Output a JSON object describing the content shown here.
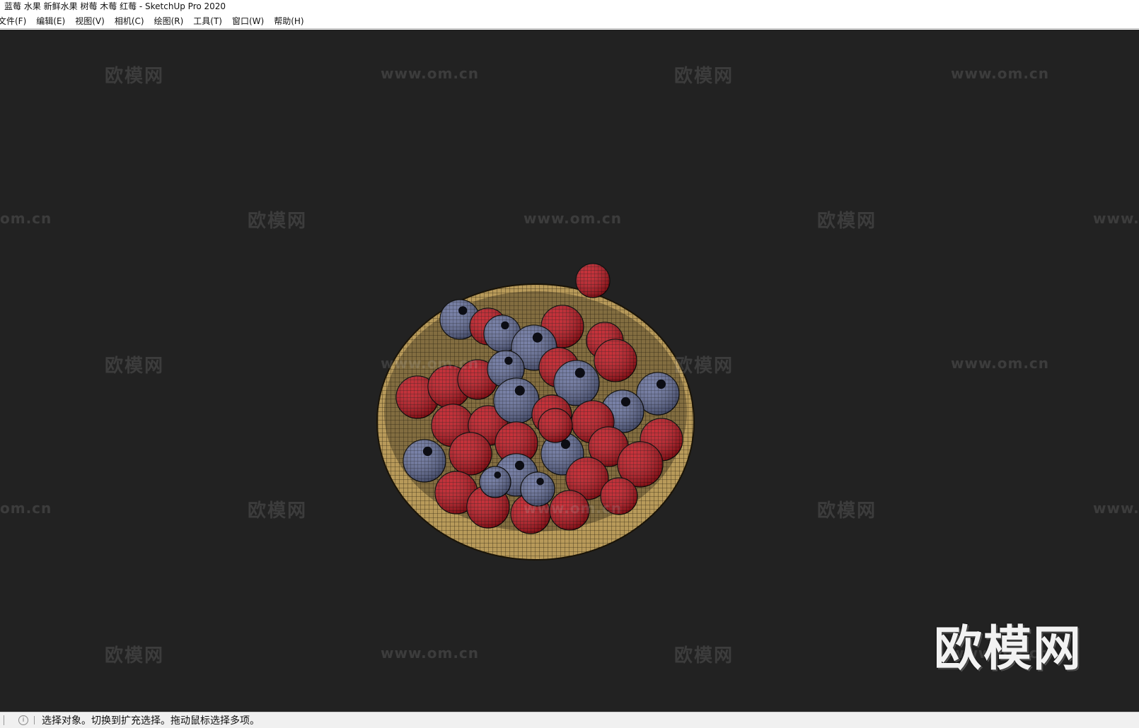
{
  "window": {
    "title": "蓝莓 水果 新鲜水果 树莓 木莓 红莓 - SketchUp Pro 2020"
  },
  "menu": {
    "items": [
      {
        "label": "文件(F)"
      },
      {
        "label": "编辑(E)"
      },
      {
        "label": "视图(V)"
      },
      {
        "label": "相机(C)"
      },
      {
        "label": "绘图(R)"
      },
      {
        "label": "工具(T)"
      },
      {
        "label": "窗口(W)"
      },
      {
        "label": "帮助(H)"
      }
    ]
  },
  "watermark": {
    "brand": "欧模网",
    "url": "www.om.cn",
    "url_partial_left": "om.cn",
    "url_partial_right": "www."
  },
  "status": {
    "info_icon": "info-icon",
    "text": "选择对象。切换到扩充选择。拖动鼠标选择多项。"
  },
  "colors": {
    "viewport_bg": "#222222",
    "raspberry": "#c0141e",
    "blueberry": "#5d6590",
    "bowl": "#b89a5a"
  }
}
